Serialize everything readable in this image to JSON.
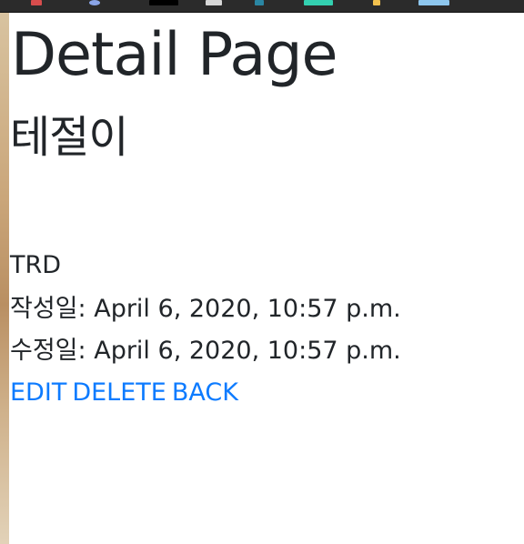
{
  "page": {
    "title": "Detail Page"
  },
  "post": {
    "title": "테절이",
    "content": "TRD",
    "created_label": "작성일",
    "created_at": "April 6, 2020, 10:57 p.m.",
    "updated_label": "수정일",
    "updated_at": "April 6, 2020, 10:57 p.m."
  },
  "actions": {
    "edit": "EDIT",
    "delete": "DELETE",
    "back": "BACK"
  },
  "colors": {
    "text": "#212529",
    "link": "#0d7bff",
    "background": "#ffffff"
  }
}
